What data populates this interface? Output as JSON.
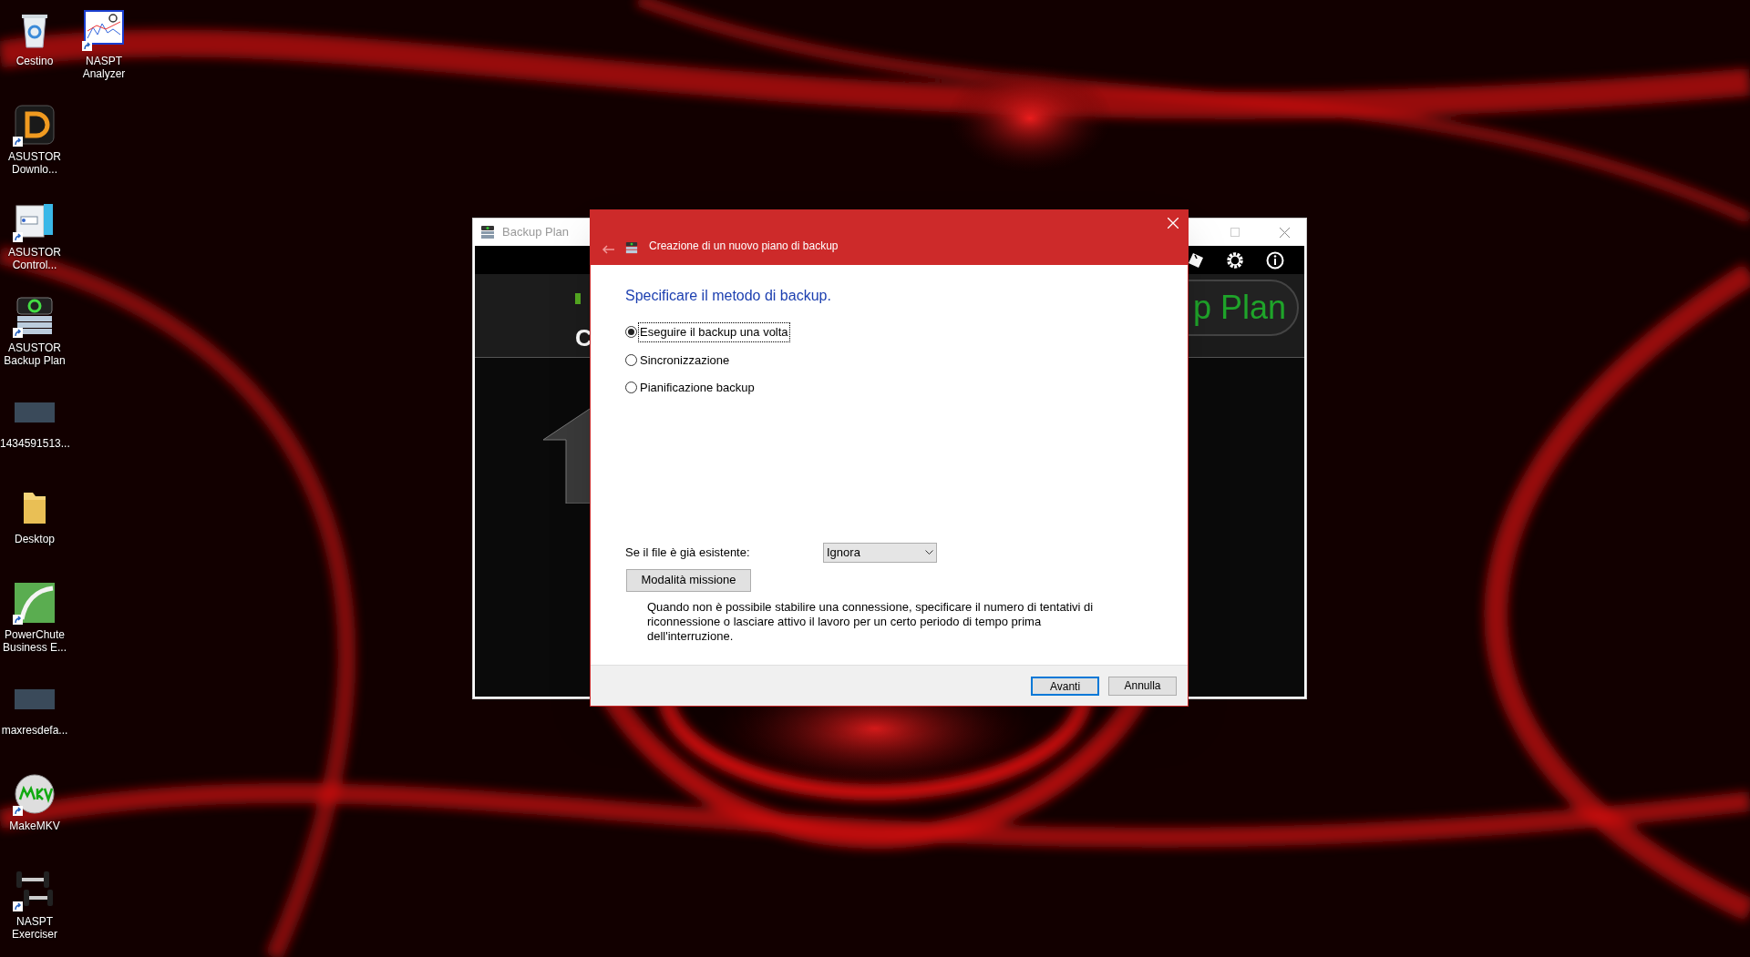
{
  "desktop_icons": [
    [
      {
        "label": "Cestino",
        "kind": "bin",
        "shortcut": false
      },
      {
        "label": "ASUSTOR Downlo...",
        "kind": "downloader",
        "shortcut": true
      },
      {
        "label": "ASUSTOR Control...",
        "kind": "control",
        "shortcut": true
      },
      {
        "label": "ASUSTOR Backup Plan",
        "kind": "backup",
        "shortcut": true
      },
      {
        "label": "1434591513...",
        "kind": "image",
        "shortcut": false
      },
      {
        "label": "Desktop",
        "kind": "folder",
        "shortcut": false
      },
      {
        "label": "PowerChute Business E...",
        "kind": "powerchute",
        "shortcut": true
      },
      {
        "label": "maxresdefa...",
        "kind": "image",
        "shortcut": false
      },
      {
        "label": "MakeMKV",
        "kind": "disc",
        "shortcut": true
      },
      {
        "label": "NASPT Exerciser",
        "kind": "dumbbell",
        "shortcut": true
      }
    ],
    [
      {
        "label": "NASPT Analyzer",
        "kind": "chart",
        "shortcut": true
      }
    ]
  ],
  "app_window": {
    "title": "Backup Plan",
    "header_letter": "C",
    "header_banner": "p Plan"
  },
  "dialog": {
    "title": "Creazione di un nuovo piano di backup",
    "heading": "Specificare il metodo di backup.",
    "options": [
      {
        "label": "Eseguire il backup una volta",
        "selected": true
      },
      {
        "label": "Sincronizzazione",
        "selected": false
      },
      {
        "label": "Pianificazione backup",
        "selected": false
      }
    ],
    "existing_file_label": "Se il file è già esistente:",
    "existing_file_value": "Ignora",
    "mission_button": "Modalità missione",
    "description": "Quando non è possibile stabilire una connessione, specificare il numero di tentativi di riconnessione o lasciare attivo il lavoro per un certo periodo di tempo prima dell'interruzione.",
    "buttons": [
      {
        "label": "Avanti",
        "default": true
      },
      {
        "label": "Annulla",
        "default": false
      }
    ]
  }
}
